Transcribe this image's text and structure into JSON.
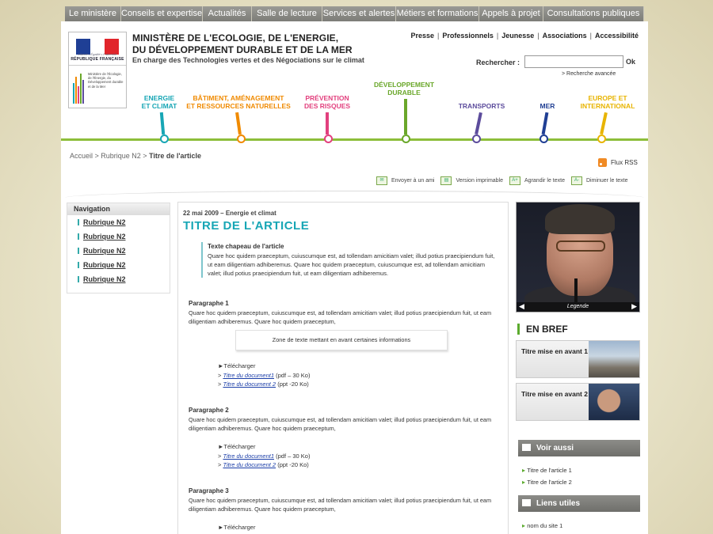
{
  "topnav": [
    "Le  ministère",
    "Conseils et expertise",
    "Actualités",
    "Salle de lecture",
    "Services et  alertes",
    "Métiers et formations",
    "Appels à projet",
    "Consultations publiques"
  ],
  "logo": {
    "motto": "Liberté • Égalité • Fraternité",
    "republic": "RÉPUBLIQUE FRANÇAISE",
    "small": "Ministère de l'Écologie, de l'Énergie, du Développement durable et de la Mer"
  },
  "header": {
    "title_line1": "MINISTÈRE DE L'ECOLOGIE, DE L'ENERGIE,",
    "title_line2": "DU DÉVELOPPEMENT DURABLE ET DE LA MER",
    "tagline": "En charge des Technologies vertes et des Négociations sur le climat"
  },
  "toplinks": [
    "Presse",
    "Professionnels",
    "Jeunesse",
    "Associations",
    "Accessibilité"
  ],
  "search": {
    "label": "Rechercher :",
    "value": "",
    "ok": "Ok",
    "advanced": "> Recherche avancée"
  },
  "themes": [
    {
      "l1": "ENERGIE",
      "l2": "ET CLIMAT",
      "color": "#17a6b5"
    },
    {
      "l1": "BÂTIMENT, AMÉNAGEMENT",
      "l2": "ET RESSOURCES NATURELLES",
      "color": "#f08a00"
    },
    {
      "l1": "PRÉVENTION",
      "l2": "DES RISQUES",
      "color": "#e2407e"
    },
    {
      "l1": "DÉVELOPPEMENT",
      "l2": "DURABLE",
      "color": "#6aa72a"
    },
    {
      "l1": "TRANSPORTS",
      "l2": "",
      "color": "#5c4c9c"
    },
    {
      "l1": "MER",
      "l2": "",
      "color": "#203f94"
    },
    {
      "l1": "EUROPE ET",
      "l2": "INTERNATIONAL",
      "color": "#e8b400"
    }
  ],
  "breadcrumb": {
    "path": "Accueil > Rubrique N2 > ",
    "current": "Titre de l'article"
  },
  "rss": "Flux RSS",
  "tools": [
    "Envoyer à un ami",
    "Version imprimable",
    "Agrandir  le texte",
    "Diminuer le texte"
  ],
  "leftnav": {
    "title": "Navigation",
    "items": [
      "Rubrique N2",
      "Rubrique N2",
      "Rubrique N2",
      "Rubrique N2",
      "Rubrique N2"
    ]
  },
  "article": {
    "date": "22 mai 2009   – Energie et climat",
    "title": "TITRE DE L'ARTICLE",
    "chapeau_title": "Texte chapeau de l'article",
    "chapeau_text": "Quare hoc quidem praeceptum, cuiuscumque est, ad tollendam amicitiam valet; illud potius praecipien­dum fuit, ut eam diligentiam adhiberemus. Quare hoc quidem praeceptum, cuiuscumque est, ad tollen­dam amicitiam valet; illud potius praecipiendum fuit, ut eam diligentiam adhiberemus.",
    "paragraphs": [
      {
        "title": "Paragraphe 1",
        "text": "Quare hoc quidem praeceptum, cuiuscumque est, ad tollendam amicitiam valet; illud potius praecipiendum fuit, ut eam diligentiam adhiberemus. Quare hoc quidem praeceptum,"
      },
      {
        "title": "Paragraphe 2",
        "text": "Quare hoc quidem praeceptum, cuiuscumque est, ad tollendam amicitiam valet; illud potius praecipiendum fuit, ut eam diligentiam adhiberemus. Quare hoc quidem praeceptum,"
      },
      {
        "title": "Paragraphe 3",
        "text": "Quare hoc quidem praeceptum, cuiuscumque est, ad tollendam amicitiam valet; illud potius praecipiendum fuit, ut eam diligentiam adhiberemus. Quare hoc quidem praeceptum,"
      }
    ],
    "highlight": "Zone de texte mettant en avant certaines informations",
    "download_label": "►Télécharger",
    "doc1": "Titre du document1",
    "doc1_meta": " (pdf – 30 Ko)",
    "doc2": "Titre du document 2",
    "doc2_meta": " (ppt -20 Ko)"
  },
  "photo": {
    "caption": "Legende"
  },
  "enbref": {
    "title": "EN BREF",
    "items": [
      "Titre mise en avant  1",
      "Titre mise en avant  2"
    ]
  },
  "voir_aussi": {
    "title": "Voir aussi",
    "items": [
      "Titre de l'article 1",
      "Titre de l'article 2"
    ]
  },
  "liens_utiles": {
    "title": "Liens utiles",
    "items": [
      "nom du site 1"
    ]
  }
}
